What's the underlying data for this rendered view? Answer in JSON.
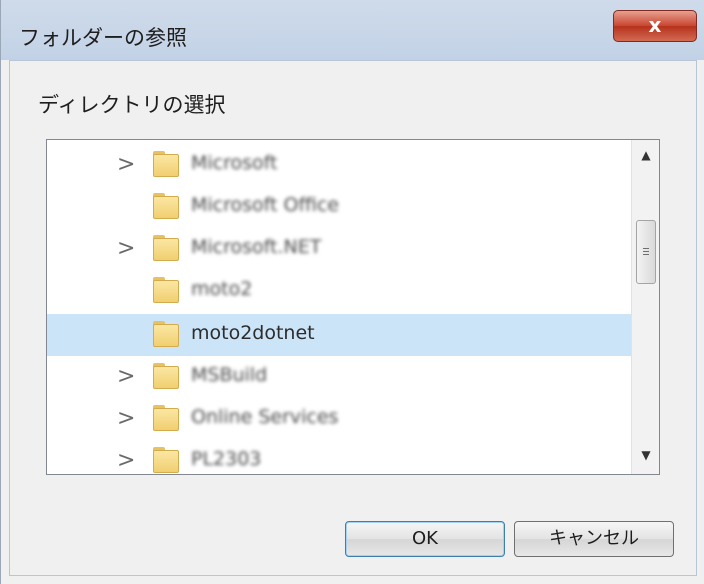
{
  "dialog": {
    "title": "フォルダーの参照",
    "close_label": "x"
  },
  "description": "ディレクトリの選択",
  "tree": {
    "items": [
      {
        "label": "Microsoft",
        "expandable": true,
        "selected": false
      },
      {
        "label": "Microsoft Office",
        "expandable": false,
        "selected": false
      },
      {
        "label": "Microsoft.NET",
        "expandable": true,
        "selected": false
      },
      {
        "label": "moto2",
        "expandable": false,
        "selected": false
      },
      {
        "label": "moto2dotnet",
        "expandable": false,
        "selected": true
      },
      {
        "label": "MSBuild",
        "expandable": true,
        "selected": false
      },
      {
        "label": "Online Services",
        "expandable": true,
        "selected": false
      },
      {
        "label": "PL2303",
        "expandable": true,
        "selected": false
      }
    ],
    "chevron_glyph": ">",
    "scroll_up_glyph": "▲",
    "scroll_down_glyph": "▼"
  },
  "buttons": {
    "ok_label": "OK",
    "cancel_label": "キャンセル"
  },
  "colors": {
    "selection": "#cce4f7",
    "folder": "#f0cf71",
    "close": "#c8452f"
  }
}
